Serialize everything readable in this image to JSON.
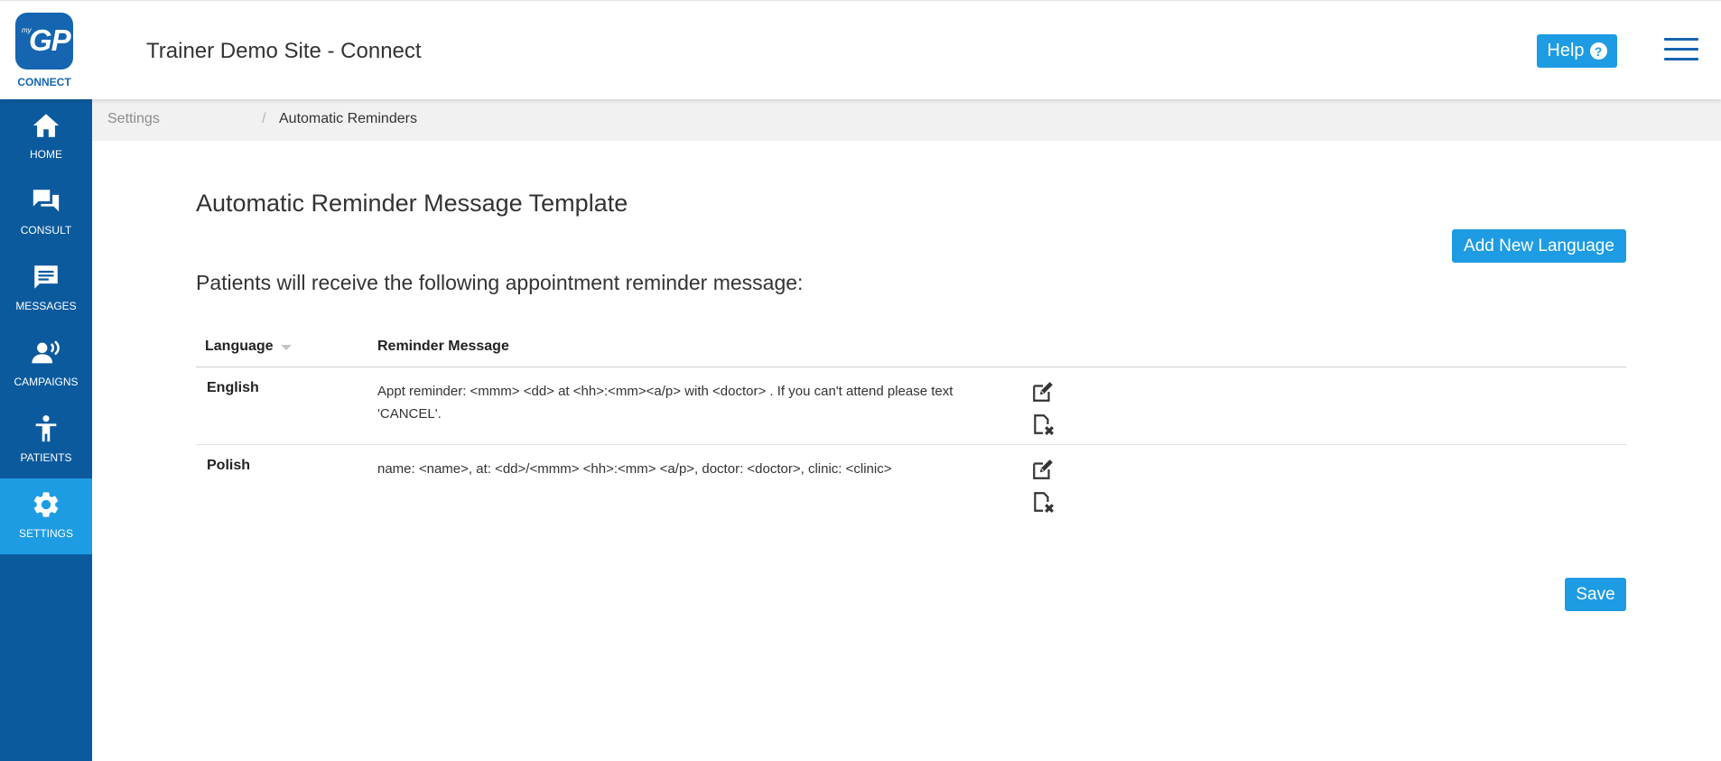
{
  "brand": {
    "logo_small": "my",
    "logo_main": "GP",
    "caption": "CONNECT"
  },
  "header": {
    "site_title": "Trainer Demo Site - Connect",
    "help_label": "Help",
    "help_icon_glyph": "?"
  },
  "sidebar": {
    "items": [
      {
        "label": "HOME",
        "icon": "home-icon",
        "active": false
      },
      {
        "label": "CONSULT",
        "icon": "chat-icon",
        "active": false
      },
      {
        "label": "MESSAGES",
        "icon": "message-icon",
        "active": false
      },
      {
        "label": "CAMPAIGNS",
        "icon": "broadcast-user-icon",
        "active": false
      },
      {
        "label": "PATIENTS",
        "icon": "person-icon",
        "active": false
      },
      {
        "label": "SETTINGS",
        "icon": "gear-icon",
        "active": true
      }
    ]
  },
  "breadcrumb": {
    "parent": "Settings",
    "separator": "/",
    "current": "Automatic Reminders"
  },
  "main": {
    "title": "Automatic Reminder Message Template",
    "add_language_label": "Add New Language",
    "subtitle": "Patients will receive the following appointment reminder message:",
    "table": {
      "columns": [
        "Language",
        "Reminder Message"
      ],
      "rows": [
        {
          "language": "English",
          "message": "Appt reminder: <mmm> <dd> at <hh>:<mm><a/p> with <doctor> . If you can't attend please text 'CANCEL'."
        },
        {
          "language": "Polish",
          "message": "name: <name>, at: <dd>/<mmm> <hh>:<mm> <a/p>, doctor: <doctor>, clinic: <clinic>"
        }
      ]
    },
    "save_label": "Save"
  },
  "colors": {
    "primary_dark": "#0c5a9e",
    "brand": "#1565b0",
    "accent": "#1e9ce3",
    "breadcrumb_bg": "#f1f1f1"
  }
}
